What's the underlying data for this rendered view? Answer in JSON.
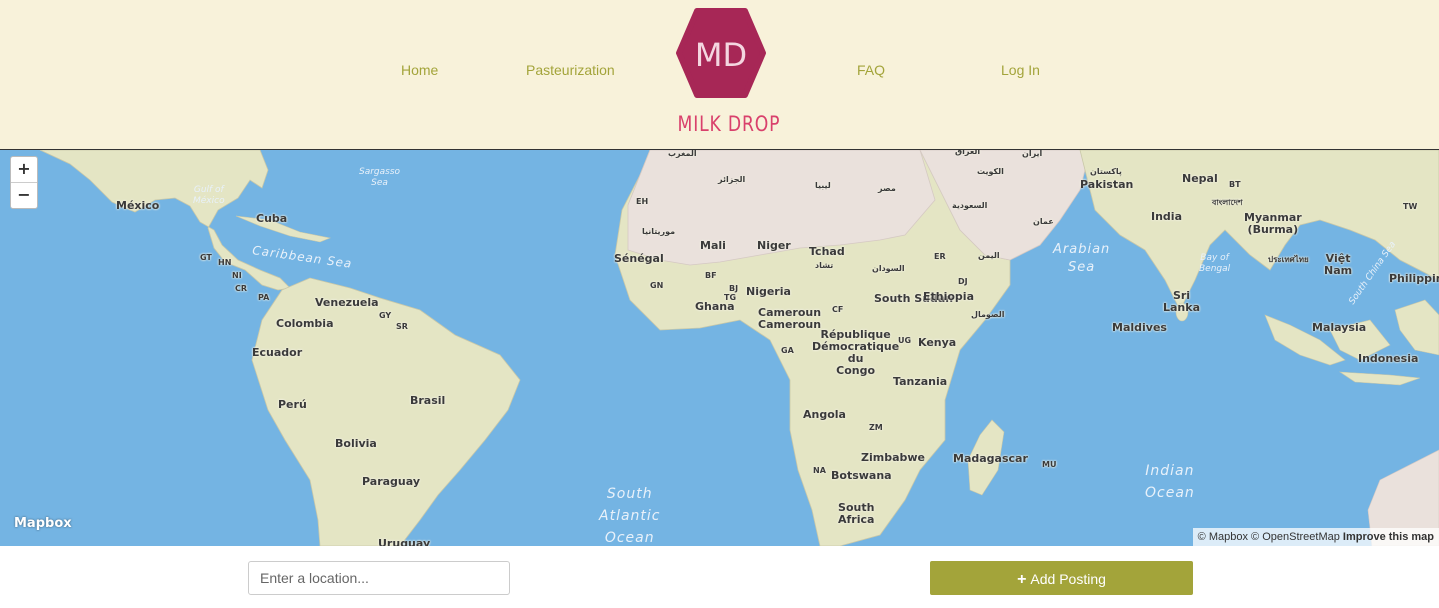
{
  "header": {
    "nav": {
      "home": "Home",
      "pasteurization": "Pasteurization",
      "faq": "FAQ",
      "login": "Log In"
    },
    "logo": {
      "monogram": "MD",
      "wordmark": "MILK DROP",
      "badge_color": "#a72756",
      "wordmark_color": "#d9416c"
    },
    "background_color": "#f8f2da",
    "link_color": "#a3a43a"
  },
  "map": {
    "zoom_in": "+",
    "zoom_out": "−",
    "logo_text": "Mapbox",
    "attribution": {
      "mapbox": "© Mapbox",
      "osm": "© OpenStreetMap",
      "improve": "Improve this map"
    },
    "ocean_color": "#74b4e3",
    "land_color": "#e4e5c4",
    "desert_color": "#eae1dc",
    "labels": {
      "mexico": "México",
      "cuba": "Cuba",
      "gt": "GT",
      "hn": "HN",
      "ni": "NI",
      "cr": "CR",
      "pa": "PA",
      "venezuela": "Venezuela",
      "gy": "GY",
      "sr": "SR",
      "colombia": "Colombia",
      "ecuador": "Ecuador",
      "peru": "Perú",
      "brasil": "Brasil",
      "bolivia": "Bolivia",
      "paraguay": "Paraguay",
      "uruguay": "Uruguay",
      "maghrib": "المغرب",
      "algeria": "الجزائر",
      "libya": "ليبيا",
      "egypt": "مصر",
      "eh": "EH",
      "mauritania": "موريتانيا",
      "mali": "Mali",
      "niger": "Niger",
      "tchad": "Tchad",
      "tchad_ar": "تشاد",
      "senegal": "Sénégal",
      "gn": "GN",
      "bf": "BF",
      "bj": "BJ",
      "tg": "TG",
      "ghana": "Ghana",
      "nigeria": "Nigeria",
      "cf": "CF",
      "cameroun": "Cameroun",
      "sudan_ar": "السودان",
      "south_sudan": "South Sudan",
      "er": "ER",
      "dj": "DJ",
      "ethiopia": "Ethiopia",
      "somalia": "الصومال",
      "yemen": "اليمن",
      "saudi": "السعودية",
      "kuwait": "الكويت",
      "oman": "عمان",
      "iran": "ایران",
      "iraq": "العراق",
      "pakistan_ur": "پاکستان",
      "pakistan": "Pakistan",
      "nepal": "Nepal",
      "bt": "BT",
      "bangladesh": "বাংলাদেশ",
      "india": "India",
      "myanmar": "Myanmar",
      "burma": "(Burma)",
      "tw": "TW",
      "thailand": "ประเทศไทย",
      "vietnam": "Việt",
      "vietnam2": "Nam",
      "philippines": "Philippine",
      "sri": "Sri",
      "lanka": "Lanka",
      "maldives": "Maldives",
      "malaysia": "Malaysia",
      "indonesia": "Indonesia",
      "ga": "GA",
      "rdc1": "République",
      "rdc2": "Démocratique",
      "rdc3": "du",
      "rdc4": "Congo",
      "ug": "UG",
      "kenya": "Kenya",
      "tanzania": "Tanzania",
      "angola": "Angola",
      "zm": "ZM",
      "zimbabwe": "Zimbabwe",
      "na": "NA",
      "botswana": "Botswana",
      "south": "South",
      "africa": "Africa",
      "madagascar": "Madagascar",
      "mu": "MU"
    },
    "seas": {
      "gulf1": "Gulf of",
      "gulf2": "México",
      "sargasso1": "Sargasso",
      "sargasso2": "Sea",
      "caribbean": "Caribbean Sea",
      "arabian1": "Arabian",
      "arabian2": "Sea",
      "bengal1": "Bay of",
      "bengal2": "Bengal",
      "scs": "South China Sea",
      "satl1": "South",
      "satl2": "Atlantic",
      "satl3": "Ocean",
      "indian1": "Indian",
      "indian2": "Ocean"
    }
  },
  "search": {
    "placeholder": "Enter a location..."
  },
  "add_posting": {
    "icon": "plus-icon",
    "label": "Add Posting",
    "color": "#a3a43a"
  }
}
